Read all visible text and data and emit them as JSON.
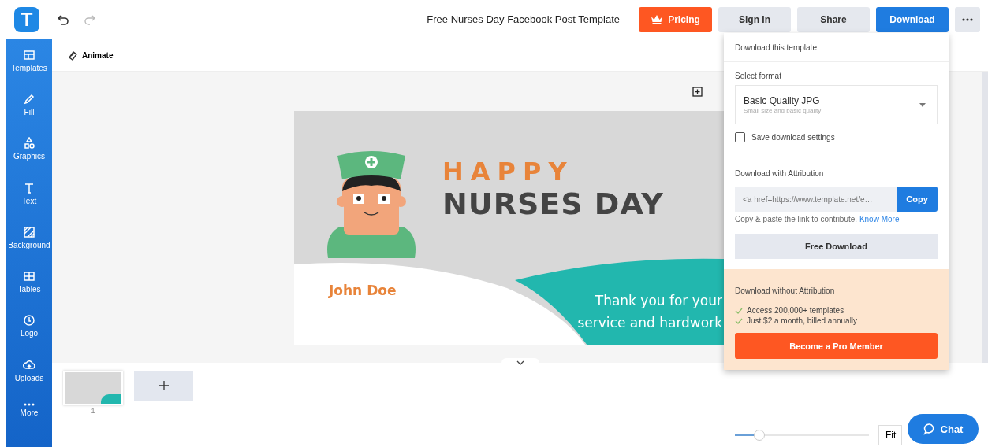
{
  "app_bar": {
    "logo_letter": "T",
    "title": "Free Nurses Day Facebook Post Template",
    "buttons": [
      {
        "label": "Pricing",
        "kind": "pricing"
      },
      {
        "label": "Sign In",
        "kind": "plain"
      },
      {
        "label": "Share",
        "kind": "plain"
      },
      {
        "label": "Download",
        "kind": "primary"
      }
    ]
  },
  "sidebar": {
    "items": [
      {
        "label": "Templates"
      },
      {
        "label": "Fill"
      },
      {
        "label": "Graphics"
      },
      {
        "label": "Text"
      },
      {
        "label": "Background"
      },
      {
        "label": "Tables"
      },
      {
        "label": "Logo"
      },
      {
        "label": "Uploads"
      },
      {
        "label": "More"
      }
    ]
  },
  "toolbar": {
    "animate": "Animate"
  },
  "design": {
    "heading_top": "HAPPY",
    "heading_main": "NURSES DAY",
    "name": "John Doe",
    "message_lines": [
      "Thank you for your",
      "service and hardwork"
    ]
  },
  "pages": [
    {
      "number": "1"
    }
  ],
  "download_panel": {
    "title": "Download this template",
    "format_label": "Select format",
    "format": {
      "value": "Basic Quality JPG",
      "description": "Small size and basic quality"
    },
    "save_settings": {
      "label": "Save download settings",
      "checked": false
    },
    "attribution_title": "Download with Attribution",
    "attribution_code": "<a href=https://www.template.net/e…",
    "copy_button": "Copy",
    "hint": "Copy & paste the link to contribute.",
    "hint_link": "Know More",
    "free_button": "Free Download",
    "pro_title": "Download without Attribution",
    "pro_benefits": [
      "Access 200,000+ templates",
      "Just $2 a month, billed annually"
    ],
    "pro_button": "Become a Pro Member"
  },
  "zoom": {
    "level": 0.18,
    "fit": "Fit"
  },
  "chat": {
    "label": "Chat"
  }
}
